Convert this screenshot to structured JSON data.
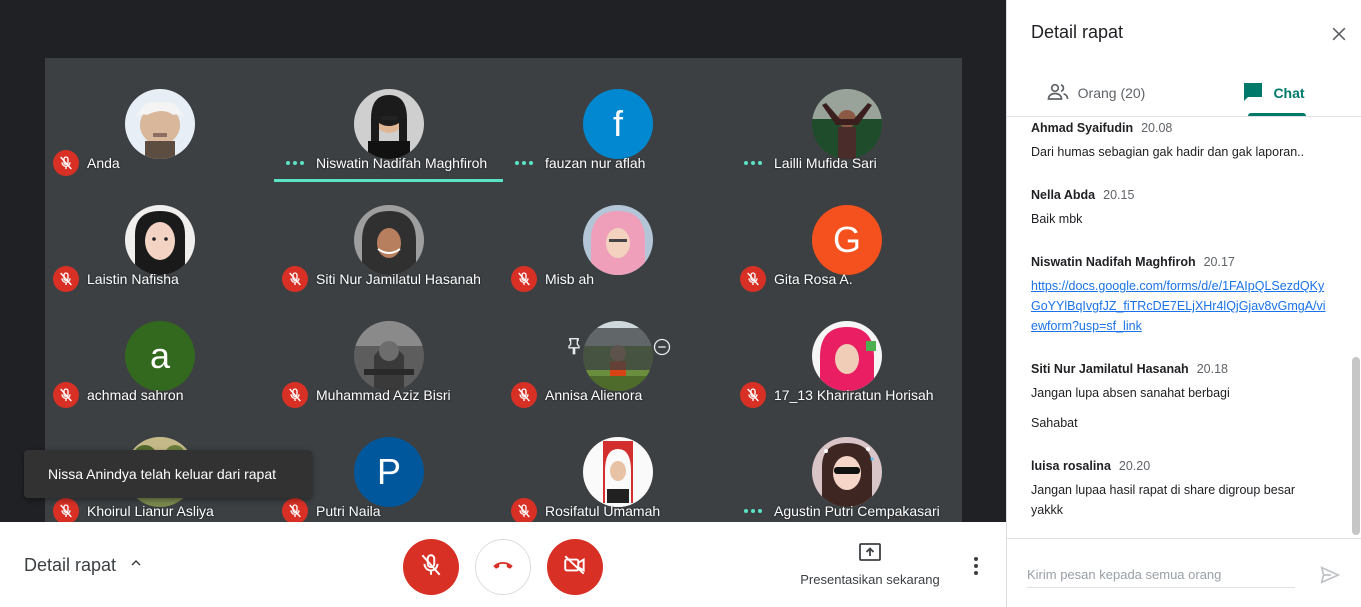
{
  "stage": {
    "participants": [
      {
        "name": "Anda",
        "status": "muted",
        "avatar": {
          "type": "photo",
          "kind": "einstein"
        }
      },
      {
        "name": "Niswatin Nadifah Maghfiroh",
        "status": "speaking",
        "avatar": {
          "type": "photo",
          "kind": "woman-dark"
        }
      },
      {
        "name": "fauzan nur aflah",
        "status": "speaking",
        "avatar": {
          "type": "letter",
          "letter": "f",
          "color": "#0288d1"
        }
      },
      {
        "name": "Lailli Mufida Sari",
        "status": "speaking",
        "avatar": {
          "type": "photo",
          "kind": "woman-arms"
        }
      },
      {
        "name": "Laistin Nafisha",
        "status": "muted",
        "avatar": {
          "type": "photo",
          "kind": "girl-face"
        }
      },
      {
        "name": "Siti Nur Jamilatul Hasanah",
        "status": "muted",
        "avatar": {
          "type": "photo",
          "kind": "hijab-gray"
        }
      },
      {
        "name": "Misb ah",
        "status": "muted",
        "avatar": {
          "type": "photo",
          "kind": "hijab-pink"
        }
      },
      {
        "name": "Gita Rosa A.",
        "status": "muted",
        "avatar": {
          "type": "letter",
          "letter": "G",
          "color": "#f4511e"
        }
      },
      {
        "name": "achmad sahron",
        "status": "muted",
        "avatar": {
          "type": "letter",
          "letter": "a",
          "color": "#33691e"
        }
      },
      {
        "name": "Muhammad Aziz Bisri",
        "status": "muted",
        "avatar": {
          "type": "photo",
          "kind": "soldier"
        }
      },
      {
        "name": "Annisa Alienora",
        "status": "muted",
        "avatar": {
          "type": "photo",
          "kind": "outdoor"
        }
      },
      {
        "name": "17_13 Khariratun Horisah",
        "status": "muted",
        "avatar": {
          "type": "photo",
          "kind": "hijab-magenta"
        }
      },
      {
        "name": "Khoirul Lianur Asliya",
        "status": "muted",
        "avatar": {
          "type": "photo",
          "kind": "nature"
        }
      },
      {
        "name": "Putri Naila",
        "status": "muted",
        "avatar": {
          "type": "letter",
          "letter": "P",
          "color": "#01579b"
        }
      },
      {
        "name": "Rosifatul Umamah",
        "status": "muted",
        "avatar": {
          "type": "photo",
          "kind": "id-photo"
        }
      },
      {
        "name": "Agustin Putri Cempakasari",
        "status": "speaking",
        "avatar": {
          "type": "photo",
          "kind": "filter-girl"
        }
      }
    ],
    "toast": "Nissa Anindya telah keluar dari rapat",
    "speaking_color": "#5be3c6",
    "muted_color": "#d93025"
  },
  "bottombar": {
    "details_label": "Detail rapat",
    "present_label": "Presentasikan sekarang"
  },
  "panel": {
    "title": "Detail rapat",
    "tabs": {
      "people": "Orang (20)",
      "chat": "Chat"
    },
    "messages": [
      {
        "sender": "Ahmad Syaifudin",
        "time": "20.08",
        "lines": [
          "Dari humas sebagian gak hadir dan gak laporan.."
        ]
      },
      {
        "sender": "Nella Abda",
        "time": "20.15",
        "lines": [
          "Baik mbk"
        ]
      },
      {
        "sender": "Niswatin Nadifah Maghfiroh",
        "time": "20.17",
        "link": "https://docs.google.com/forms/d/e/1FAIpQLSezdQKyGoYYlBqIvgfJZ_fiTRcDE7ELjXHr4lQjGjav8vGmgA/viewform?usp=sf_link"
      },
      {
        "sender": "Siti Nur Jamilatul Hasanah",
        "time": "20.18",
        "lines": [
          "Jangan lupa absen sanahat berbagi",
          "",
          "Sahabat"
        ]
      },
      {
        "sender": "luisa rosalina",
        "time": "20.20",
        "lines": [
          "Jangan lupaa hasil rapat di share digroup besar",
          "yakkk"
        ]
      }
    ],
    "input_placeholder": "Kirim pesan kepada semua orang",
    "accent": "#00796b"
  }
}
